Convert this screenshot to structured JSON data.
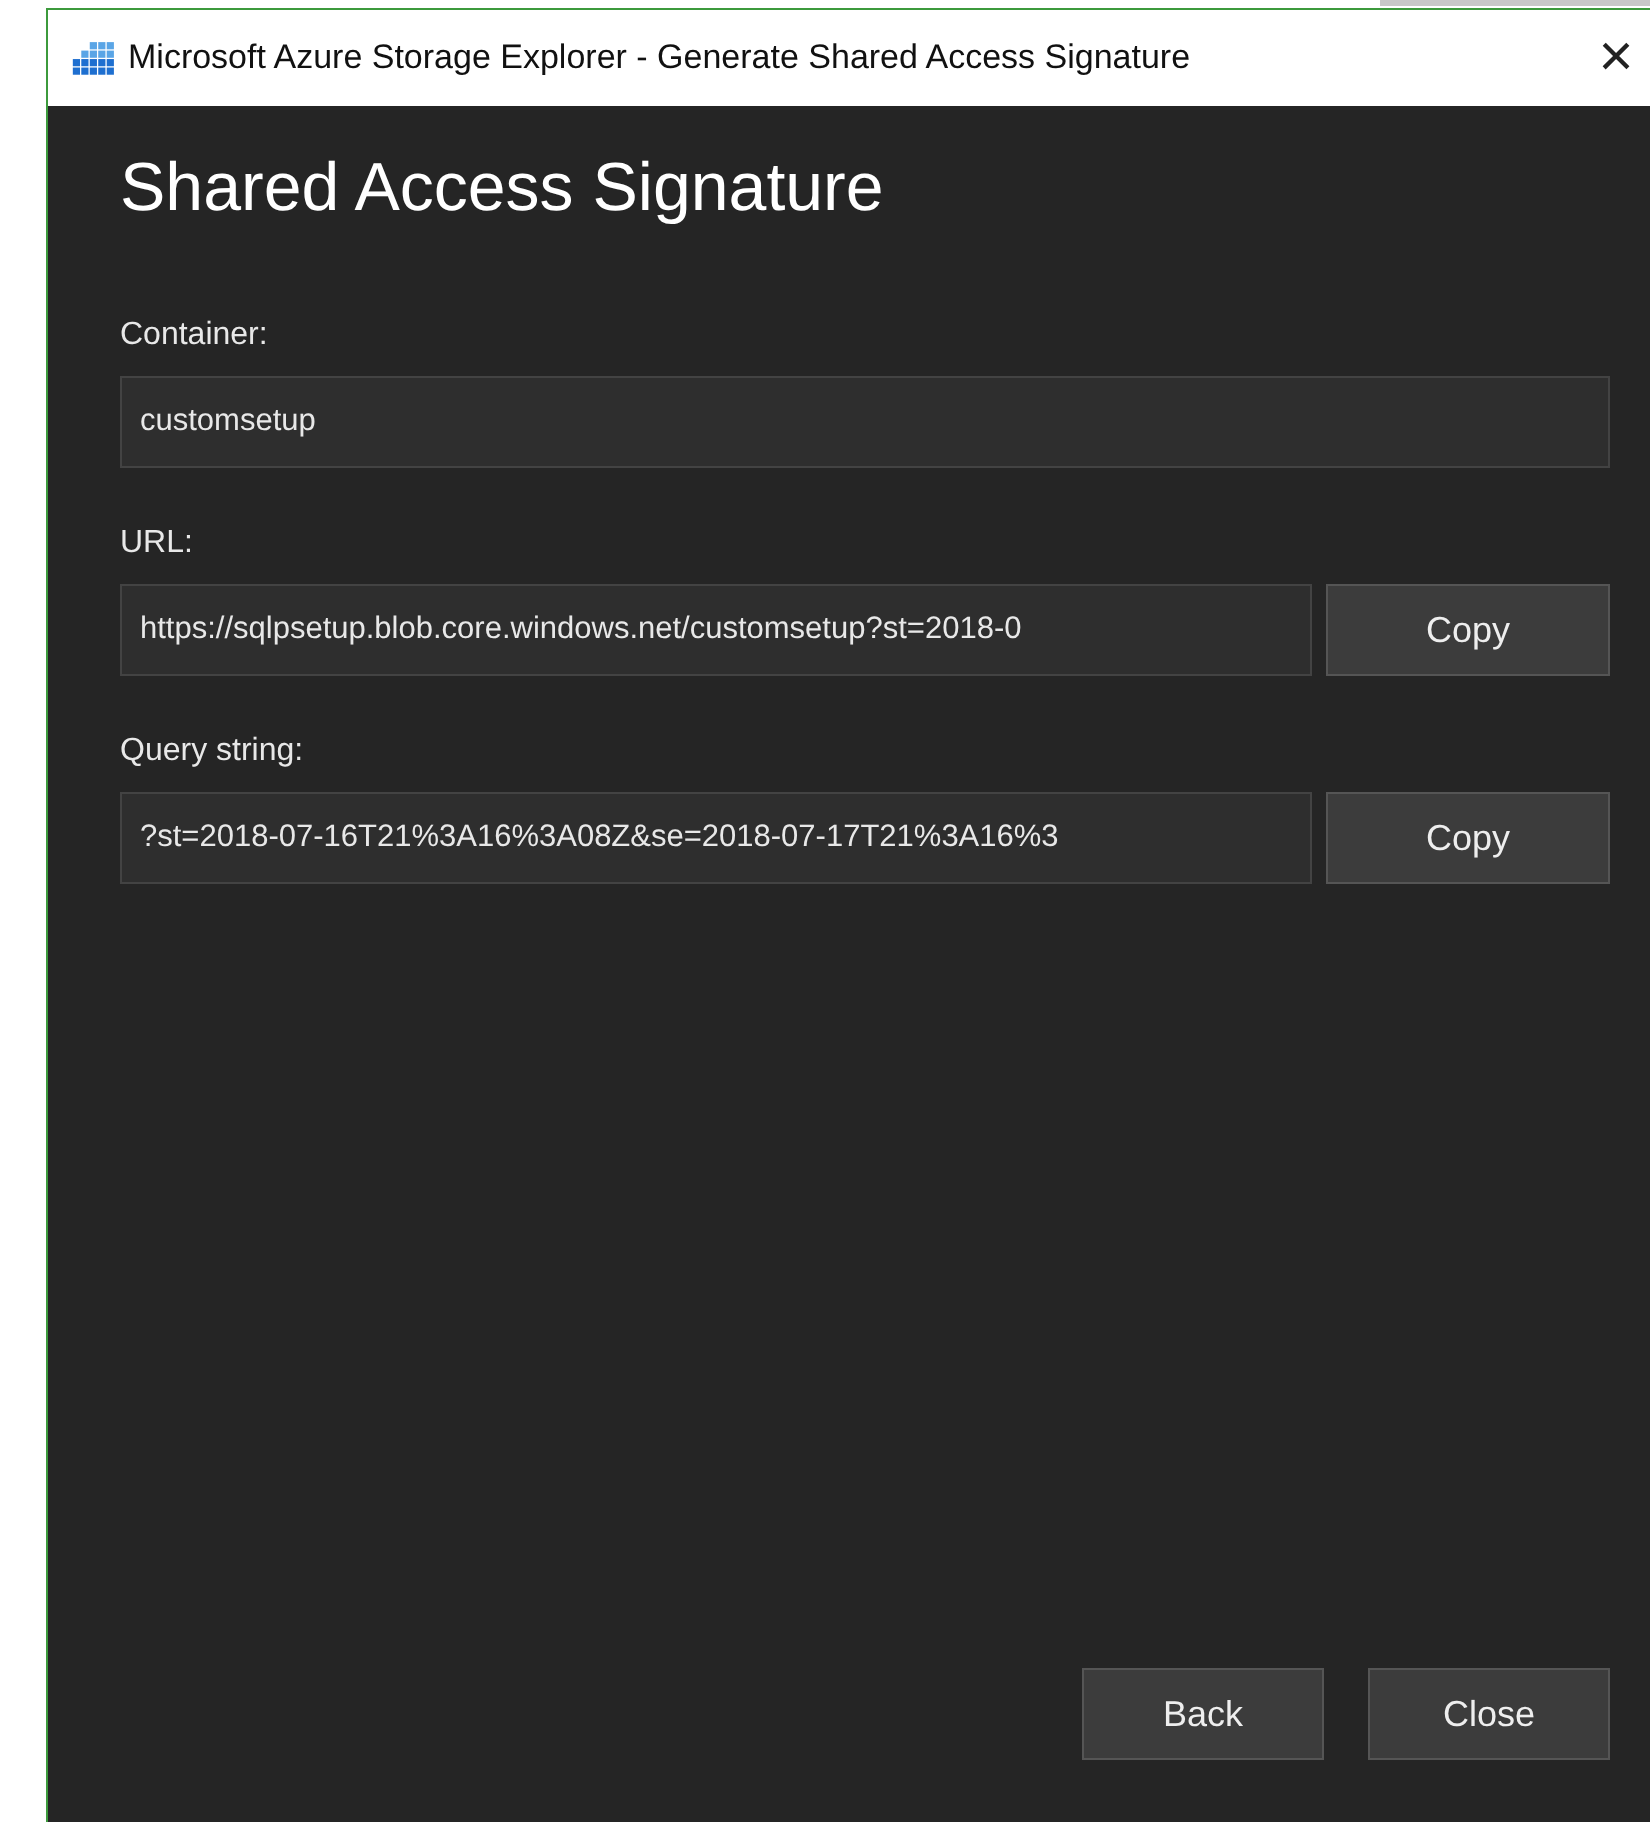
{
  "window": {
    "title": "Microsoft Azure Storage Explorer - Generate Shared Access Signature",
    "close": "×"
  },
  "heading": "Shared Access Signature",
  "fields": [
    {
      "label": "Container:",
      "value": "customsetup"
    },
    {
      "label": "URL:",
      "value": "https://sqlpsetup.blob.core.windows.net/customsetup?st=2018-0",
      "copy": "Copy"
    },
    {
      "label": "Query string:",
      "value": "?st=2018-07-16T21%3A16%3A08Z&se=2018-07-17T21%3A16%3",
      "copy": "Copy"
    }
  ],
  "buttons": [
    "Back",
    "Close"
  ]
}
